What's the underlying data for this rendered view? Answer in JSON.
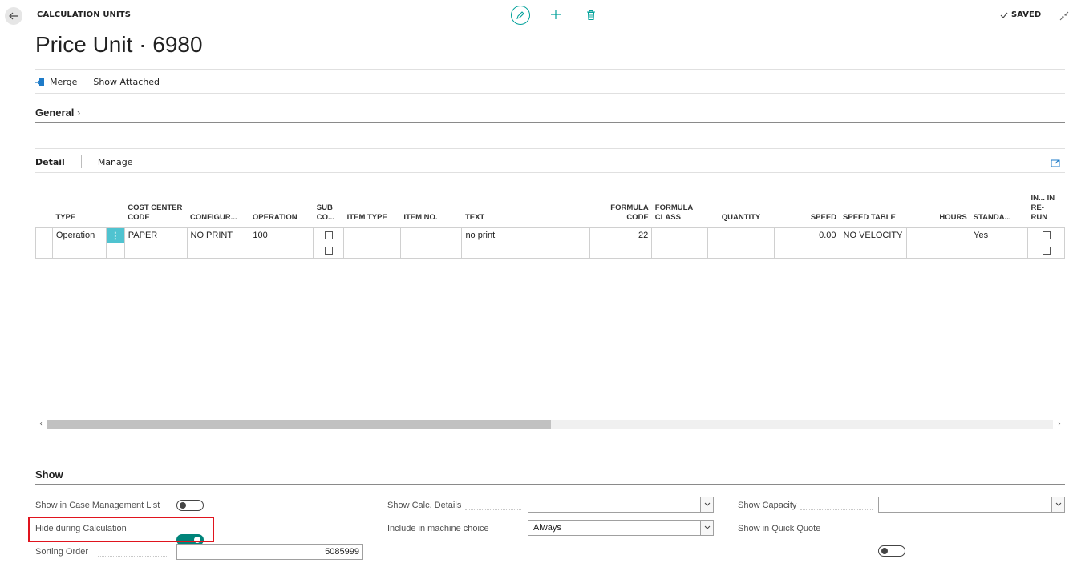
{
  "header": {
    "breadcrumb": "CALCULATION UNITS",
    "title": "Price Unit · 6980",
    "status": "SAVED"
  },
  "actions": {
    "merge": "Merge",
    "show_attached": "Show Attached"
  },
  "sections": {
    "general": "General",
    "show": "Show"
  },
  "tabs": {
    "detail": "Detail",
    "manage": "Manage"
  },
  "grid": {
    "columns": {
      "type": "TYPE",
      "cost_center_code": "COST CENTER CODE",
      "configur": "CONFIGUR...",
      "operation": "OPERATION",
      "sub_co": "SUB CO...",
      "item_type": "ITEM TYPE",
      "item_no": "ITEM NO.",
      "text": "TEXT",
      "formula_code": "FORMULA CODE",
      "formula_class": "FORMULA CLASS",
      "quantity": "QUANTITY",
      "speed": "SPEED",
      "speed_table": "SPEED TABLE",
      "hours": "HOURS",
      "standa": "STANDA...",
      "in_rerun": "IN... IN RE- RUN"
    },
    "row1": {
      "type": "Operation",
      "cost_center_code": "PAPER",
      "configur": "NO PRINT",
      "operation": "100",
      "text": "no print",
      "formula_code": "22",
      "speed": "0.00",
      "speed_table": "NO VELOCITY",
      "standa": "Yes"
    }
  },
  "fields": {
    "show_in_case_mgmt": {
      "label": "Show in Case Management List",
      "value": false
    },
    "hide_during_calc": {
      "label": "Hide during Calculation",
      "value": true
    },
    "sorting_order": {
      "label": "Sorting Order",
      "value": "5085999"
    },
    "show_calc_details": {
      "label": "Show Calc. Details",
      "value": ""
    },
    "include_machine_choice": {
      "label": "Include in machine choice",
      "value": "Always"
    },
    "show_capacity": {
      "label": "Show Capacity",
      "value": ""
    },
    "show_in_quick_quote": {
      "label": "Show in Quick Quote",
      "value": false
    }
  },
  "colors": {
    "accent": "#00a19a",
    "toggle_on": "#00847a",
    "highlight": "#e0141e",
    "row_menu": "#4fc3d0"
  }
}
